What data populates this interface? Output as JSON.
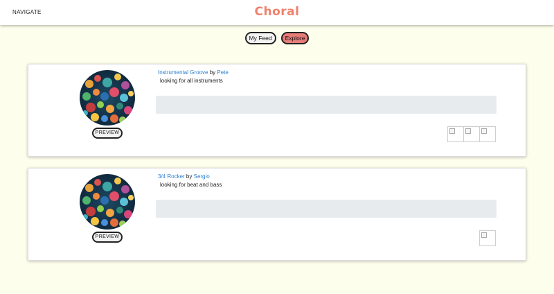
{
  "header": {
    "nav_label": "NAVIGATE",
    "brand": "Choral",
    "brand_color": "#f0806b"
  },
  "tabs": [
    {
      "label": "My Feed",
      "active": false
    },
    {
      "label": "Explore",
      "active": true,
      "color": "#e77c78"
    }
  ],
  "posts": [
    {
      "track": "Instrumental Groove",
      "by": "by",
      "user": "Pete",
      "description": "looking for all instruments",
      "preview_label": "PREVIEW",
      "contributors": 3
    },
    {
      "track": "3/4 Rocker",
      "by": "by",
      "user": "Sergio",
      "description": "looking for beat and bass",
      "preview_label": "PREVIEW",
      "contributors": 1
    }
  ],
  "colors": {
    "background": "#fefeec",
    "link": "#2f7fd0",
    "waveform": "#e8ebee"
  }
}
